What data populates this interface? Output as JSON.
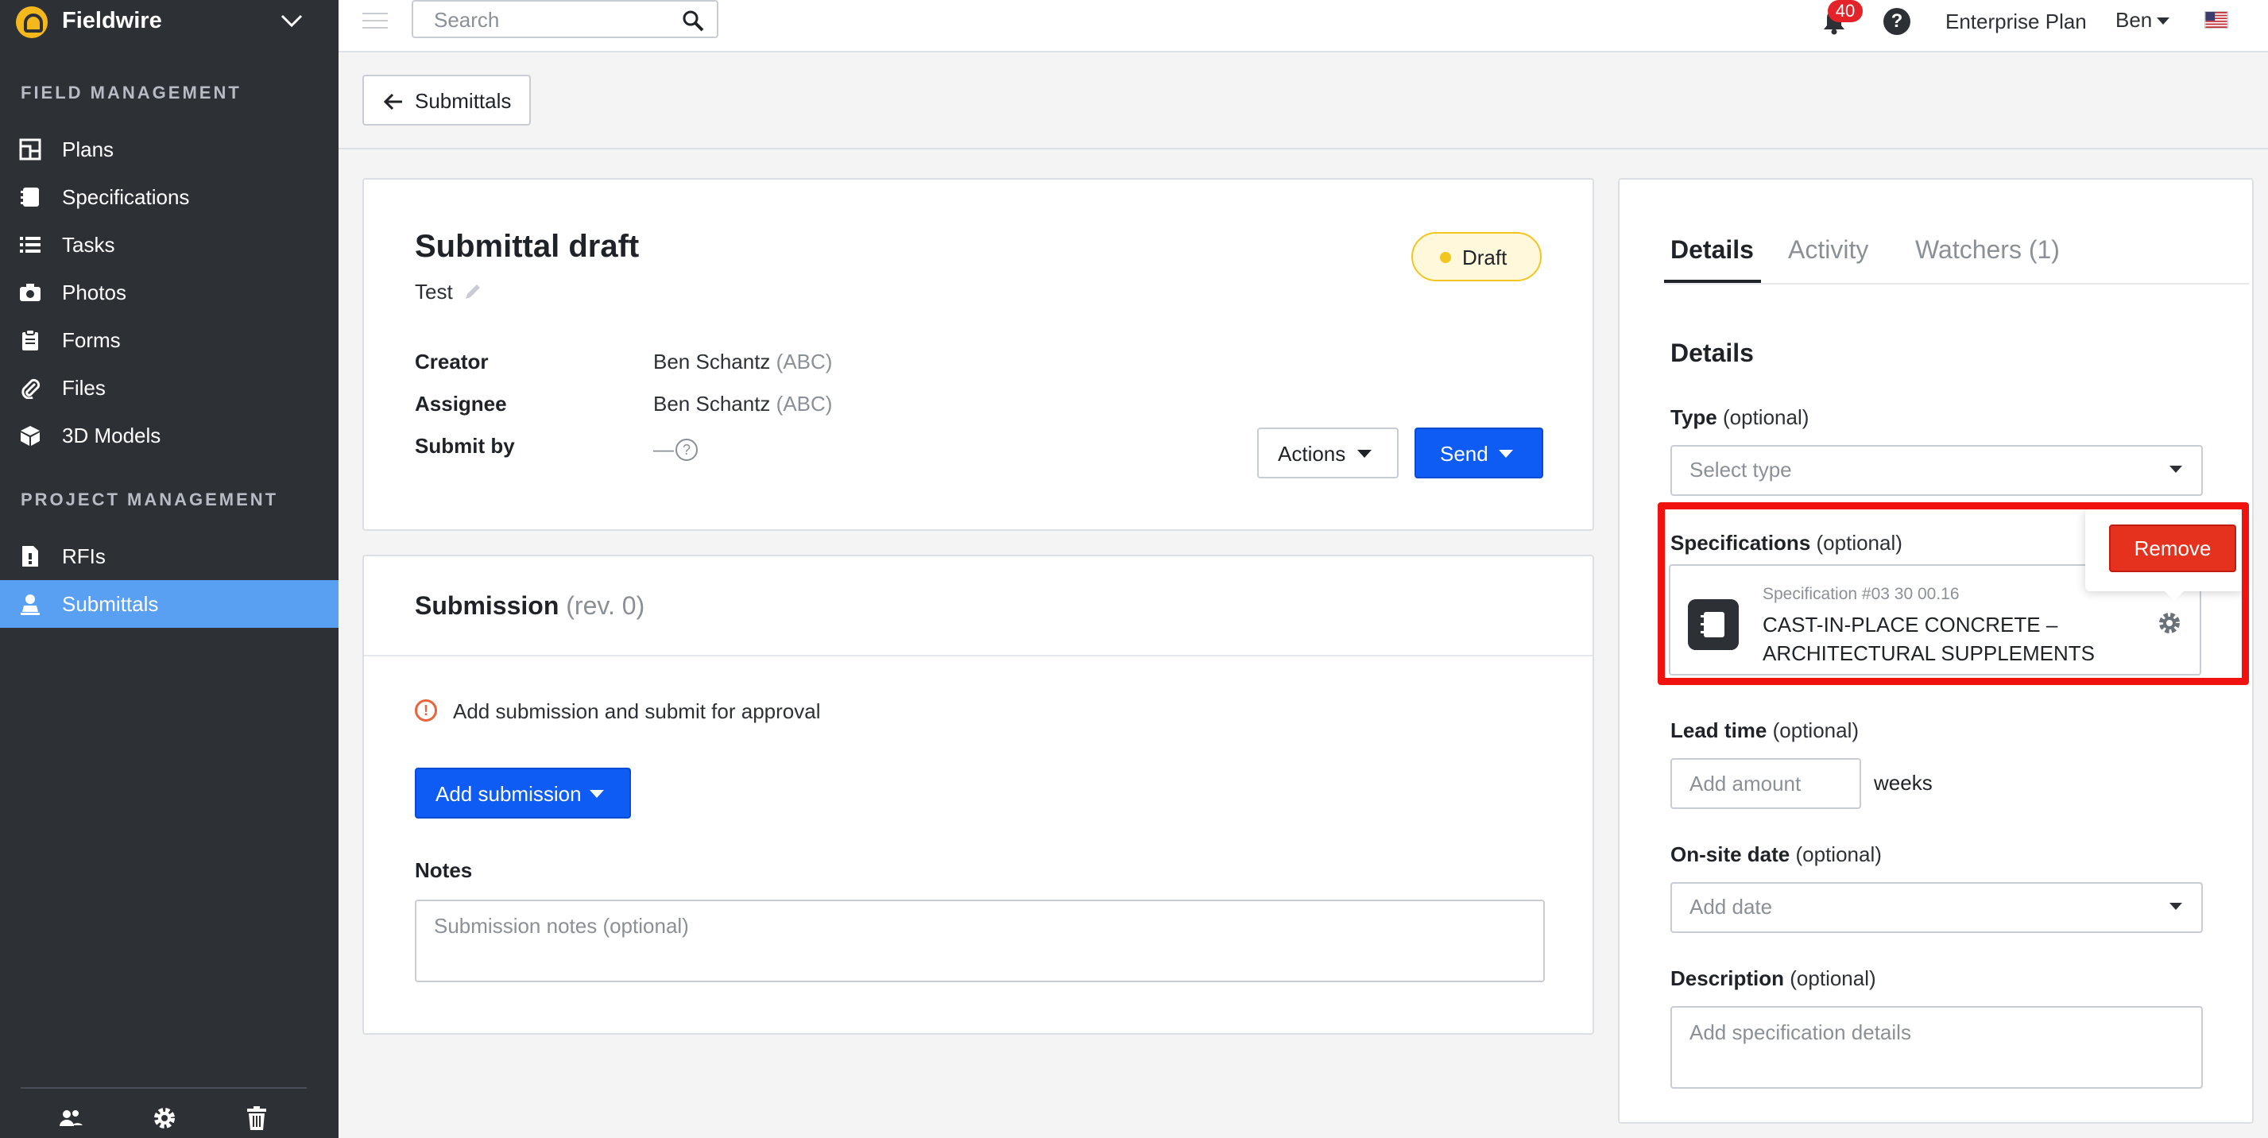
{
  "app": {
    "name": "Fieldwire"
  },
  "sidebar": {
    "sections": [
      {
        "label": "FIELD MANAGEMENT"
      },
      {
        "label": "PROJECT MANAGEMENT"
      }
    ],
    "items": [
      {
        "label": "Plans",
        "icon": "plans-icon"
      },
      {
        "label": "Specifications",
        "icon": "specifications-icon"
      },
      {
        "label": "Tasks",
        "icon": "tasks-icon"
      },
      {
        "label": "Photos",
        "icon": "camera-icon"
      },
      {
        "label": "Forms",
        "icon": "clipboard-icon"
      },
      {
        "label": "Files",
        "icon": "paperclip-icon"
      },
      {
        "label": "3D Models",
        "icon": "cube-icon"
      },
      {
        "label": "RFIs",
        "icon": "rfi-icon"
      },
      {
        "label": "Submittals",
        "icon": "submittals-icon",
        "active": true
      }
    ],
    "footer_icons": [
      "people-icon",
      "gear-icon",
      "trash-icon"
    ],
    "active_color": "#5aa0f2"
  },
  "topbar": {
    "search_placeholder": "Search",
    "notifications_count": "40",
    "help": "?",
    "plan": "Enterprise Plan",
    "user": "Ben"
  },
  "back_button": {
    "label": "Submittals"
  },
  "submittal": {
    "title": "Submittal draft",
    "subtitle": "Test",
    "status": "Draft",
    "fields": [
      {
        "key": "Creator",
        "name": "Ben Schantz",
        "org": "(ABC)"
      },
      {
        "key": "Assignee",
        "name": "Ben Schantz",
        "org": "(ABC)"
      },
      {
        "key": "Submit by",
        "name": "—",
        "org": ""
      }
    ],
    "actions_label": "Actions",
    "send_label": "Send"
  },
  "submission": {
    "title": "Submission",
    "rev": "(rev. 0)",
    "warning": "Add submission and submit for approval",
    "add_label": "Add submission",
    "notes_label": "Notes",
    "notes_placeholder": "Submission notes (optional)"
  },
  "details_panel": {
    "tabs": [
      "Details",
      "Activity",
      "Watchers (1)"
    ],
    "heading": "Details",
    "type": {
      "label": "Type",
      "optional": "(optional)",
      "placeholder": "Select type"
    },
    "specifications": {
      "label": "Specifications",
      "optional": "(optional)",
      "item": {
        "number": "Specification #03 30 00.16",
        "title": "CAST-IN-PLACE CONCRETE – ARCHITECTURAL SUPPLEMENTS"
      },
      "remove_label": "Remove"
    },
    "lead_time": {
      "label": "Lead time",
      "optional": "(optional)",
      "placeholder": "Add amount",
      "unit": "weeks"
    },
    "onsite_date": {
      "label": "On-site date",
      "optional": "(optional)",
      "placeholder": "Add date"
    },
    "description": {
      "label": "Description",
      "optional": "(optional)",
      "placeholder": "Add specification details"
    }
  },
  "colors": {
    "primary": "#0f5cf4",
    "danger": "#e5321f",
    "draft": "#f3c61f",
    "highlight": "#f0120e"
  }
}
